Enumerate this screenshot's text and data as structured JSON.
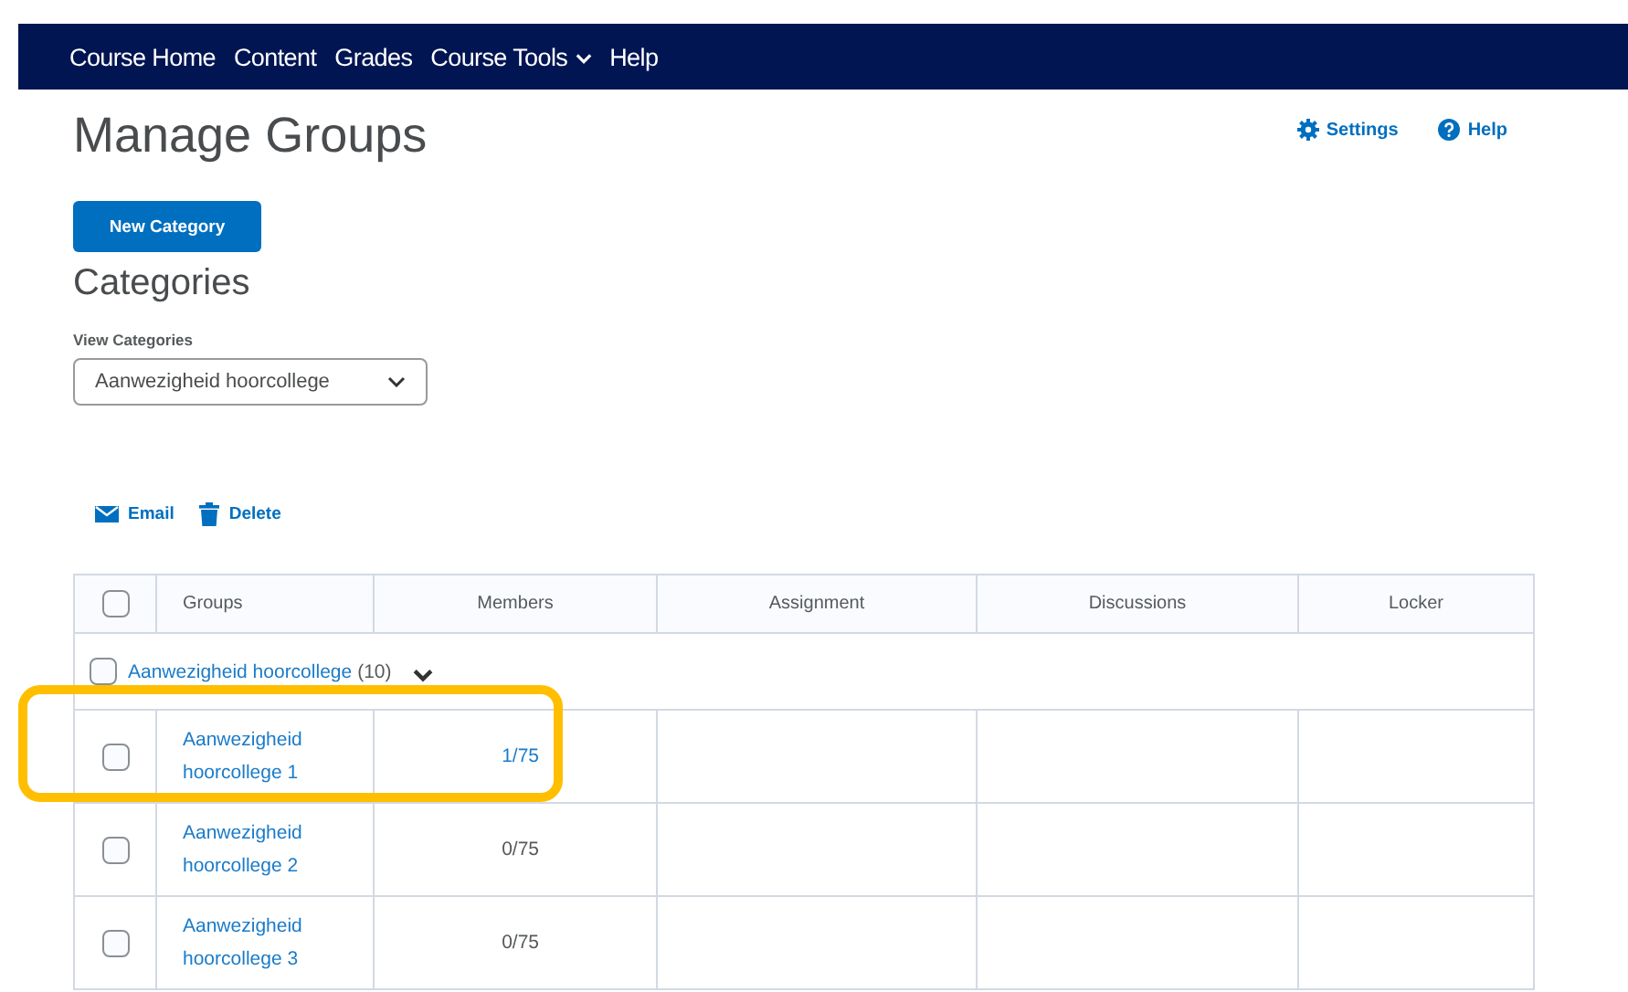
{
  "nav": [
    {
      "label": "Course Home",
      "dropdown": false
    },
    {
      "label": "Content",
      "dropdown": false
    },
    {
      "label": "Grades",
      "dropdown": false
    },
    {
      "label": "Course Tools",
      "dropdown": true
    },
    {
      "label": "Help",
      "dropdown": false
    }
  ],
  "page_title": "Manage Groups",
  "header_links": [
    {
      "kind": "settings",
      "label": "Settings"
    },
    {
      "kind": "help",
      "label": "Help"
    }
  ],
  "new_category_button": "New Category",
  "section_title": "Categories",
  "view_categories": {
    "label": "View Categories",
    "value": "Aanwezigheid hoorcollege"
  },
  "actions": [
    {
      "kind": "email",
      "label": "Email"
    },
    {
      "kind": "delete",
      "label": "Delete"
    }
  ],
  "table": {
    "select_all_checked": false,
    "columns": [
      "Groups",
      "Members",
      "Assignment",
      "Discussions",
      "Locker"
    ],
    "category_row": {
      "checked": false,
      "name": "Aanwezigheid hoorcollege",
      "count": "(10)",
      "expanded": true
    },
    "rows": [
      {
        "checked": false,
        "name": "Aanwezigheid hoorcollege 1",
        "members": "1/75",
        "members_link": true,
        "highlighted": true
      },
      {
        "checked": false,
        "name": "Aanwezigheid hoorcollege 2",
        "members": "0/75",
        "members_link": false,
        "highlighted": false
      },
      {
        "checked": false,
        "name": "Aanwezigheid hoorcollege 3",
        "members": "0/75",
        "members_link": false,
        "highlighted": false
      }
    ]
  }
}
